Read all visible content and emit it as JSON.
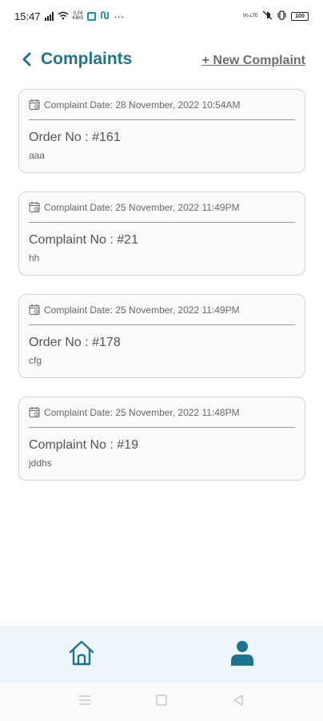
{
  "status_bar": {
    "time": "15:47",
    "net_speed_top": "0.24",
    "net_speed_bottom": "KB/S",
    "volte": "Vo LTE",
    "battery": "100"
  },
  "header": {
    "title": "Complaints",
    "new_complaint_label": "+ New Complaint"
  },
  "complaints": [
    {
      "date": "Complaint Date: 28 November, 2022 10:54AM",
      "number": "Order No : #161",
      "description": "aaa"
    },
    {
      "date": "Complaint Date: 25 November, 2022 11:49PM",
      "number": "Complaint No : #21",
      "description": "hh"
    },
    {
      "date": "Complaint Date: 25 November, 2022 11:49PM",
      "number": "Order No : #178",
      "description": "cfg"
    },
    {
      "date": "Complaint Date: 25 November, 2022 11:48PM",
      "number": "Complaint No : #19",
      "description": "jddhs"
    }
  ],
  "bottom_nav": {
    "items": [
      {
        "icon": "home-icon"
      },
      {
        "icon": "user-icon",
        "active": true
      }
    ]
  },
  "colors": {
    "accent": "#1b7590",
    "nav_background": "#eef6f9"
  }
}
